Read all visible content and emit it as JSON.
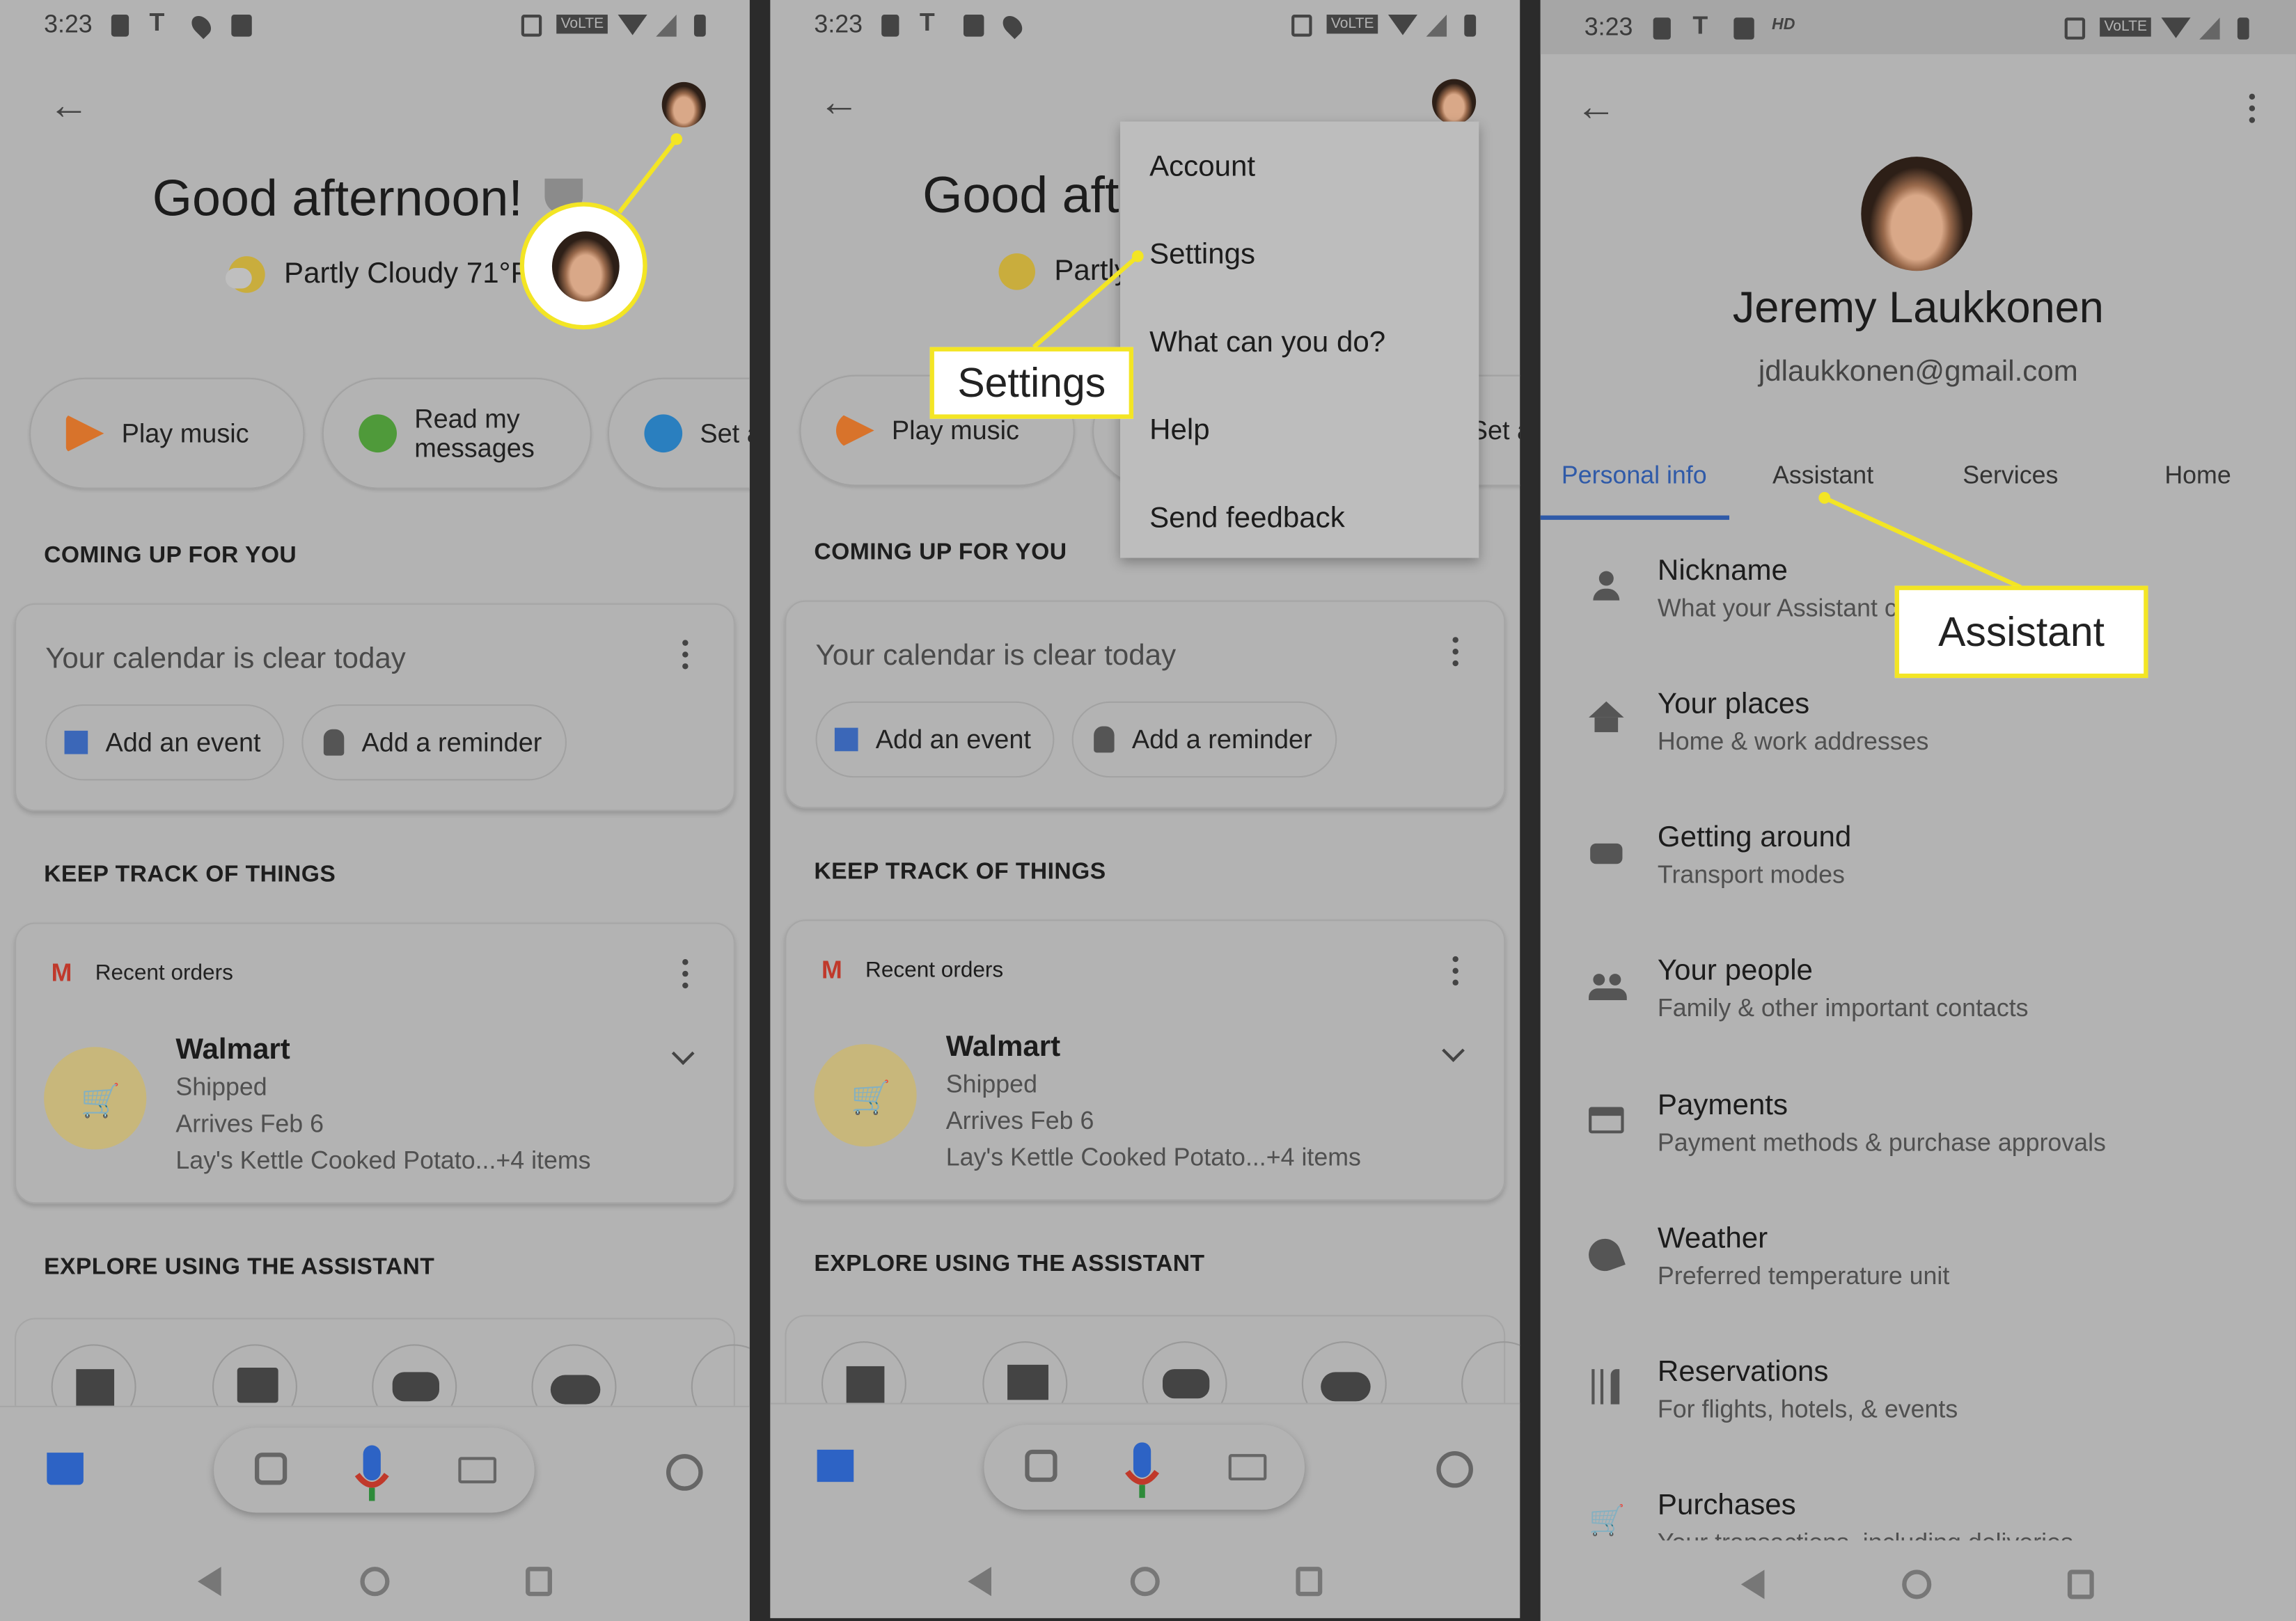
{
  "status_bar": {
    "time": "3:23",
    "volte": "VoLTE",
    "hd": "HD"
  },
  "home": {
    "greeting": "Good afternoon!",
    "weather": "Partly Cloudy 71°F",
    "chips": [
      {
        "label": "Play music",
        "icon": "play-music-icon"
      },
      {
        "label": "Read my messages",
        "icon": "messages-icon"
      },
      {
        "label": "Set a",
        "icon": "alarm-icon"
      }
    ],
    "coming_up_heading": "COMING UP FOR YOU",
    "calendar_text": "Your calendar is clear today",
    "add_event": "Add an event",
    "add_reminder": "Add a reminder",
    "keep_track_heading": "KEEP TRACK OF THINGS",
    "recent_orders": "Recent orders",
    "order": {
      "store": "Walmart",
      "status": "Shipped",
      "arrival": "Arrives Feb 6",
      "items": "Lay's Kettle Cooked Potato...+4 items"
    },
    "explore_heading": "EXPLORE USING THE ASSISTANT"
  },
  "menu": {
    "items": [
      "Account",
      "Settings",
      "What can you do?",
      "Help",
      "Send feedback"
    ]
  },
  "callouts": {
    "settings": "Settings",
    "assistant": "Assistant"
  },
  "account": {
    "name": "Jeremy Laukkonen",
    "email": "jdlaukkonen@gmail.com",
    "tabs": [
      "Personal info",
      "Assistant",
      "Services",
      "Home"
    ],
    "active_tab": "Personal info",
    "items": [
      {
        "title": "Nickname",
        "subtitle": "What your Assistant calls you",
        "icon": "person-icon"
      },
      {
        "title": "Your places",
        "subtitle": "Home & work addresses",
        "icon": "home-icon"
      },
      {
        "title": "Getting around",
        "subtitle": "Transport modes",
        "icon": "car-icon"
      },
      {
        "title": "Your people",
        "subtitle": "Family & other important contacts",
        "icon": "people-icon"
      },
      {
        "title": "Payments",
        "subtitle": "Payment methods & purchase approvals",
        "icon": "credit-card-icon"
      },
      {
        "title": "Weather",
        "subtitle": "Preferred temperature unit",
        "icon": "weather-icon"
      },
      {
        "title": "Reservations",
        "subtitle": "For flights, hotels, & events",
        "icon": "restaurant-icon"
      },
      {
        "title": "Purchases",
        "subtitle": "Your transactions, including deliveries",
        "icon": "cart-icon"
      }
    ]
  },
  "colors": {
    "background": "#b3b3b3",
    "callout": "#f3e524",
    "accent": "#2f5aa8",
    "divider": "#2b2b2b"
  }
}
